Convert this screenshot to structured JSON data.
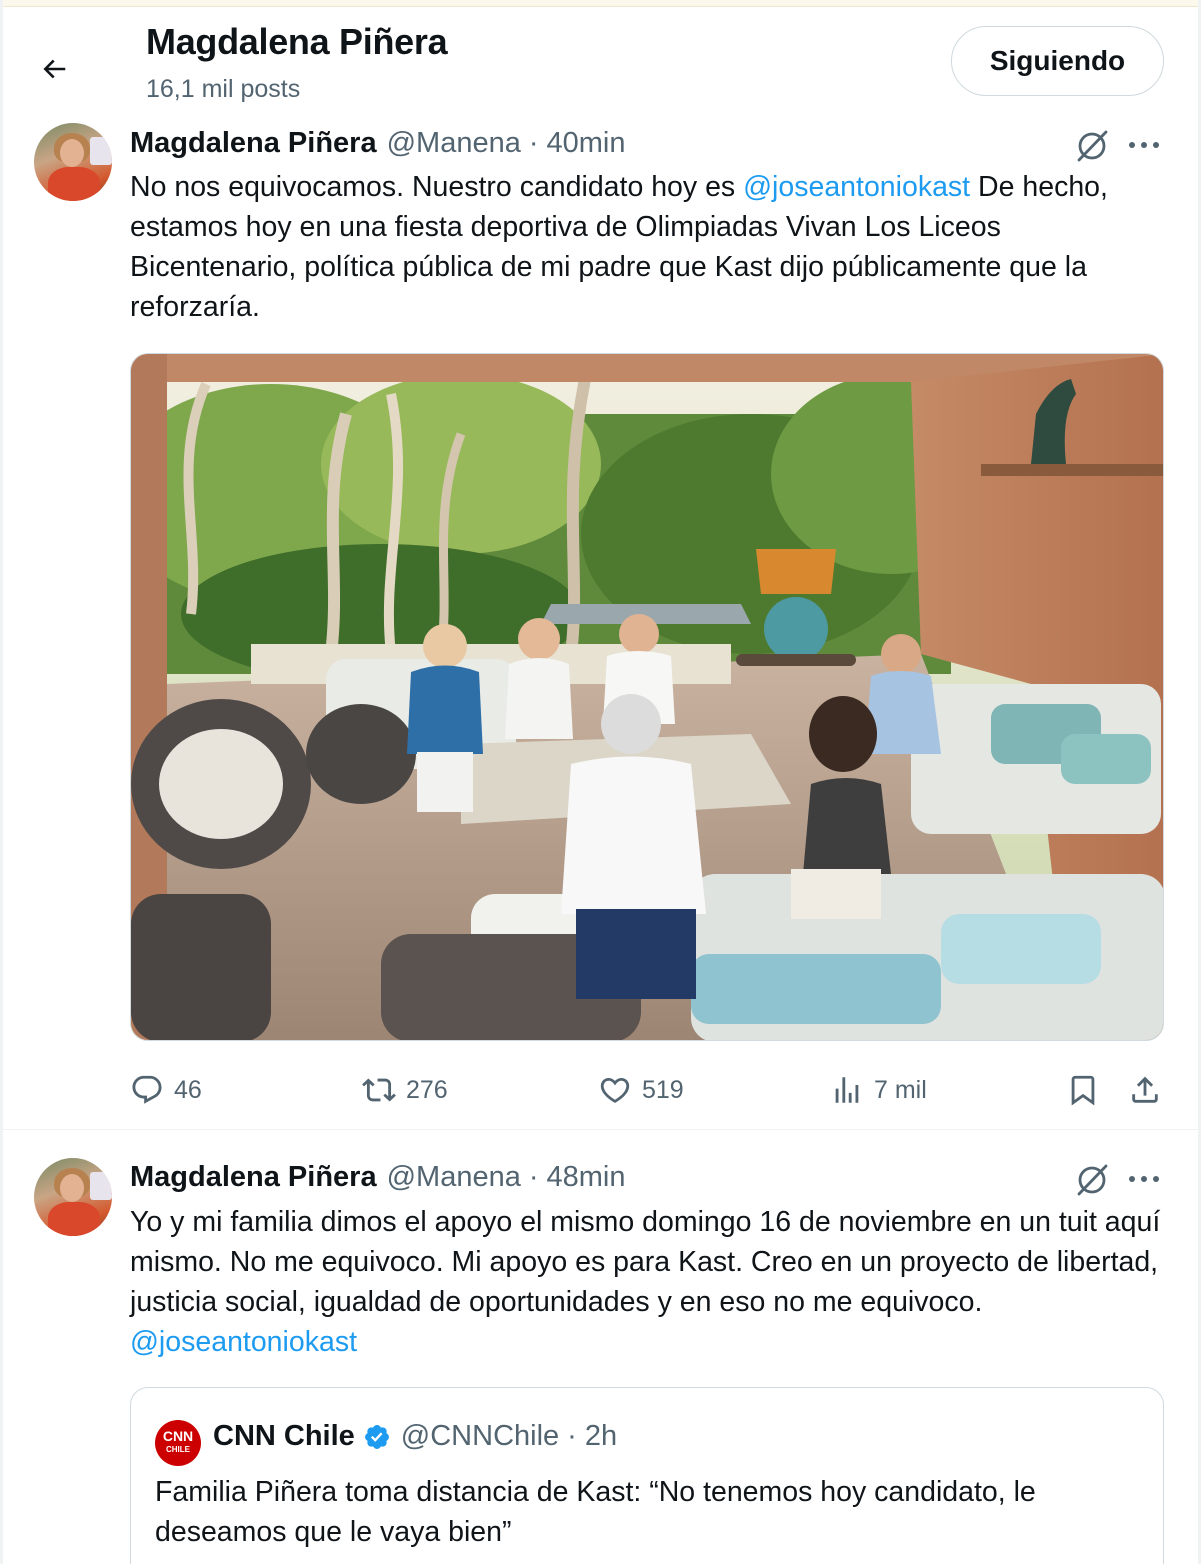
{
  "header": {
    "name": "Magdalena Piñera",
    "posts_count": "16,1 mil posts",
    "follow_label": "Siguiendo"
  },
  "tweets": [
    {
      "author": "Magdalena Piñera",
      "handle": "@Manena",
      "separator": "·",
      "time": "40min",
      "text_before": "No nos equivocamos. Nuestro candidato hoy es ",
      "mention": "@joseantoniokast",
      "text_after": " De hecho, estamos hoy en una fiesta deportiva de Olimpiadas Vivan Los Liceos Bicentenario, política pública de mi padre que Kast dijo públicamente que la reforzaría.",
      "stats": {
        "replies": "46",
        "reposts": "276",
        "likes": "519",
        "views": "7 mil"
      }
    },
    {
      "author": "Magdalena Piñera",
      "handle": "@Manena",
      "separator": "·",
      "time": "48min",
      "text_before": "Yo y mi familia dimos el apoyo el mismo domingo 16 de noviembre en un tuit aquí mismo. No me equivoco. Mi apoyo es para Kast. Creo en un proyecto de libertad, justicia social, igualdad de oportunidades y en eso no me equivoco. ",
      "mention": "@joseantoniokast",
      "quote": {
        "logo_text": "CNN",
        "logo_sub": "CHILE",
        "author": "CNN Chile",
        "handle": "@CNNChile",
        "separator": "·",
        "time": "2h",
        "text": "Familia Piñera toma distancia de Kast: “No tenemos hoy candidato, le deseamos que le vaya bien”"
      }
    }
  ],
  "colors": {
    "link": "#1d9bf0",
    "secondary_text": "#536471",
    "border": "#cfd9de",
    "verified": "#1d9bf0",
    "cnn_red": "#cc0000"
  },
  "icons": [
    "back-arrow-icon",
    "grok-icon",
    "more-icon",
    "reply-icon",
    "repost-icon",
    "like-icon",
    "views-icon",
    "bookmark-icon",
    "share-icon",
    "verified-badge-icon"
  ]
}
